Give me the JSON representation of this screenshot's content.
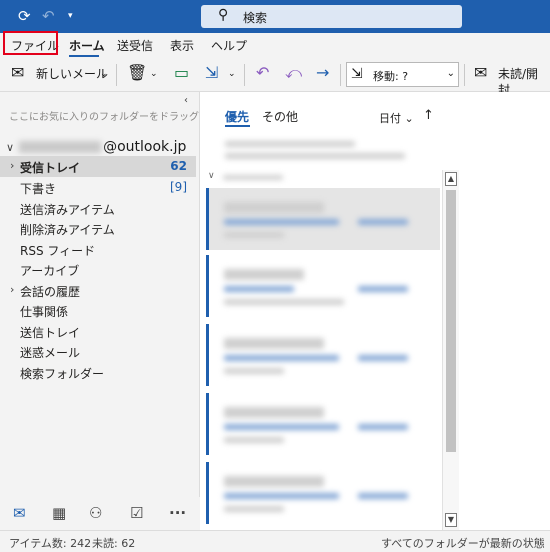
{
  "titlebar": {
    "search_text": "検索",
    "icons": [
      "sync-icon",
      "undo-icon",
      "customize-dropdown-icon",
      "search-icon"
    ]
  },
  "menu": {
    "tabs": [
      "ファイル",
      "ホーム",
      "送受信",
      "表示",
      "ヘルプ"
    ],
    "active_tab": "ホーム",
    "highlighted_tab": "ファイル"
  },
  "ribbon": {
    "new_mail": "新しいメール",
    "move_label": "移動: ?",
    "unread_read": "未読/開封",
    "icons": [
      "new-mail-icon",
      "delete-icon",
      "archive-icon",
      "move-to-icon",
      "reply-icon",
      "reply-all-icon",
      "forward-icon",
      "move-icon",
      "envelope-icon"
    ]
  },
  "folders": {
    "favorites_hint": "ここにお気に入りのフォルダーをドラッグします",
    "account": "@outlook.jp",
    "items": [
      {
        "label": "受信トレイ",
        "count": "62",
        "expand": "›",
        "selected": true
      },
      {
        "label": "下書き",
        "count": "[9]"
      },
      {
        "label": "送信済みアイテム"
      },
      {
        "label": "削除済みアイテム"
      },
      {
        "label": "RSS フィード"
      },
      {
        "label": "アーカイブ"
      },
      {
        "label": "会話の履歴",
        "expand": "›"
      },
      {
        "label": "仕事関係"
      },
      {
        "label": "送信トレイ"
      },
      {
        "label": "迷惑メール"
      },
      {
        "label": "検索フォルダー"
      }
    ]
  },
  "bottom_nav": [
    "mail-icon",
    "calendar-icon",
    "people-icon",
    "tasks-icon",
    "more-icon"
  ],
  "message_list": {
    "tab_focused": "優先",
    "tab_other": "その他",
    "sort_label": "日付",
    "sort_arrow": "↑",
    "group_arrow": "∨"
  },
  "status": {
    "items": "アイテム数: 242",
    "unread": "未読: 62",
    "sync": "すべてのフォルダーが最新の状態"
  },
  "colors": {
    "accent": "#1f5fae",
    "highlight_box": "#e3001b"
  }
}
